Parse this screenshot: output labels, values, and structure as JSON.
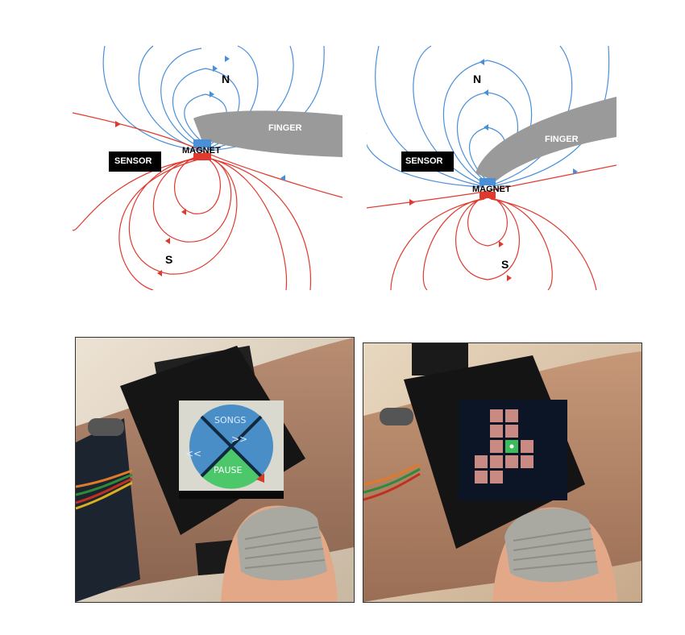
{
  "diagram_left": {
    "north": "N",
    "south": "S",
    "finger": "FINGER",
    "magnet": "MAGNET",
    "sensor": "SENSOR"
  },
  "diagram_right": {
    "north": "N",
    "south": "S",
    "finger": "FINGER",
    "magnet": "MAGNET",
    "sensor": "SENSOR"
  },
  "photo_left": {
    "menu": {
      "top": "SONGS",
      "left": "<<",
      "right": ">>",
      "bottom": "PAUSE"
    }
  },
  "photo_right": {
    "grid_note": ""
  },
  "colors": {
    "field_north": "#4a90d9",
    "field_south": "#e03a2f",
    "finger": "#9a9a9a",
    "menu_circle": "#4a8ec8",
    "menu_pause": "#4cc86a",
    "grid_cell": "#c98a84",
    "grid_active": "#3dbb5c"
  }
}
